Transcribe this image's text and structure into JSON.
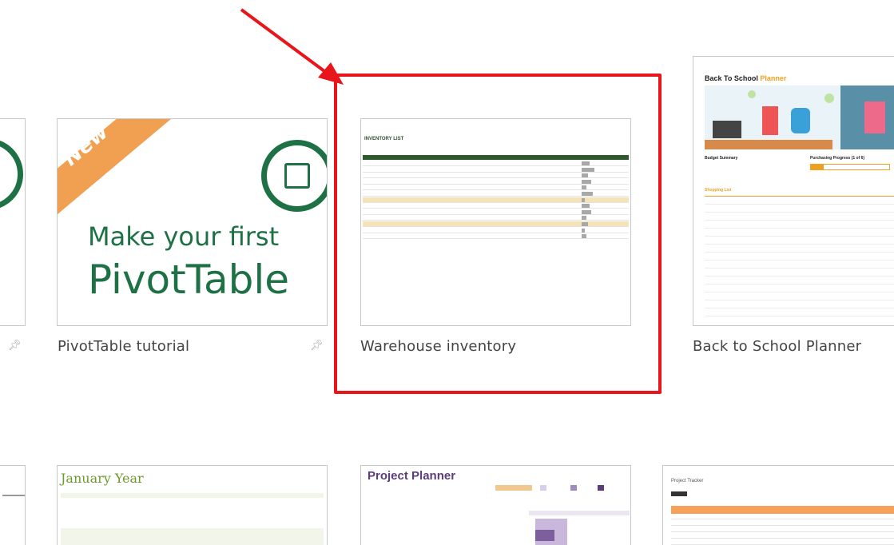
{
  "templates": [
    {
      "label": "PivotTable tutorial",
      "badge": "New",
      "line1": "Make your first",
      "line2": "PivotTable"
    },
    {
      "label": "Warehouse inventory",
      "doc_title": "INVENTORY LIST"
    },
    {
      "label": "Back to School Planner",
      "doc_title_a": "Back To School",
      "doc_title_b": "Planner",
      "budget": "Budget Summary",
      "progress": "Purchasing Progress (1 of 6)",
      "list": "Shopping List"
    },
    {
      "doc_title": "January Year"
    },
    {
      "doc_title": "Project Planner"
    },
    {
      "doc_title": "Project Tracker"
    }
  ],
  "colors": {
    "highlight": "#e8161b",
    "excel_green": "#1e7145",
    "ribbon": "#f0a050"
  }
}
